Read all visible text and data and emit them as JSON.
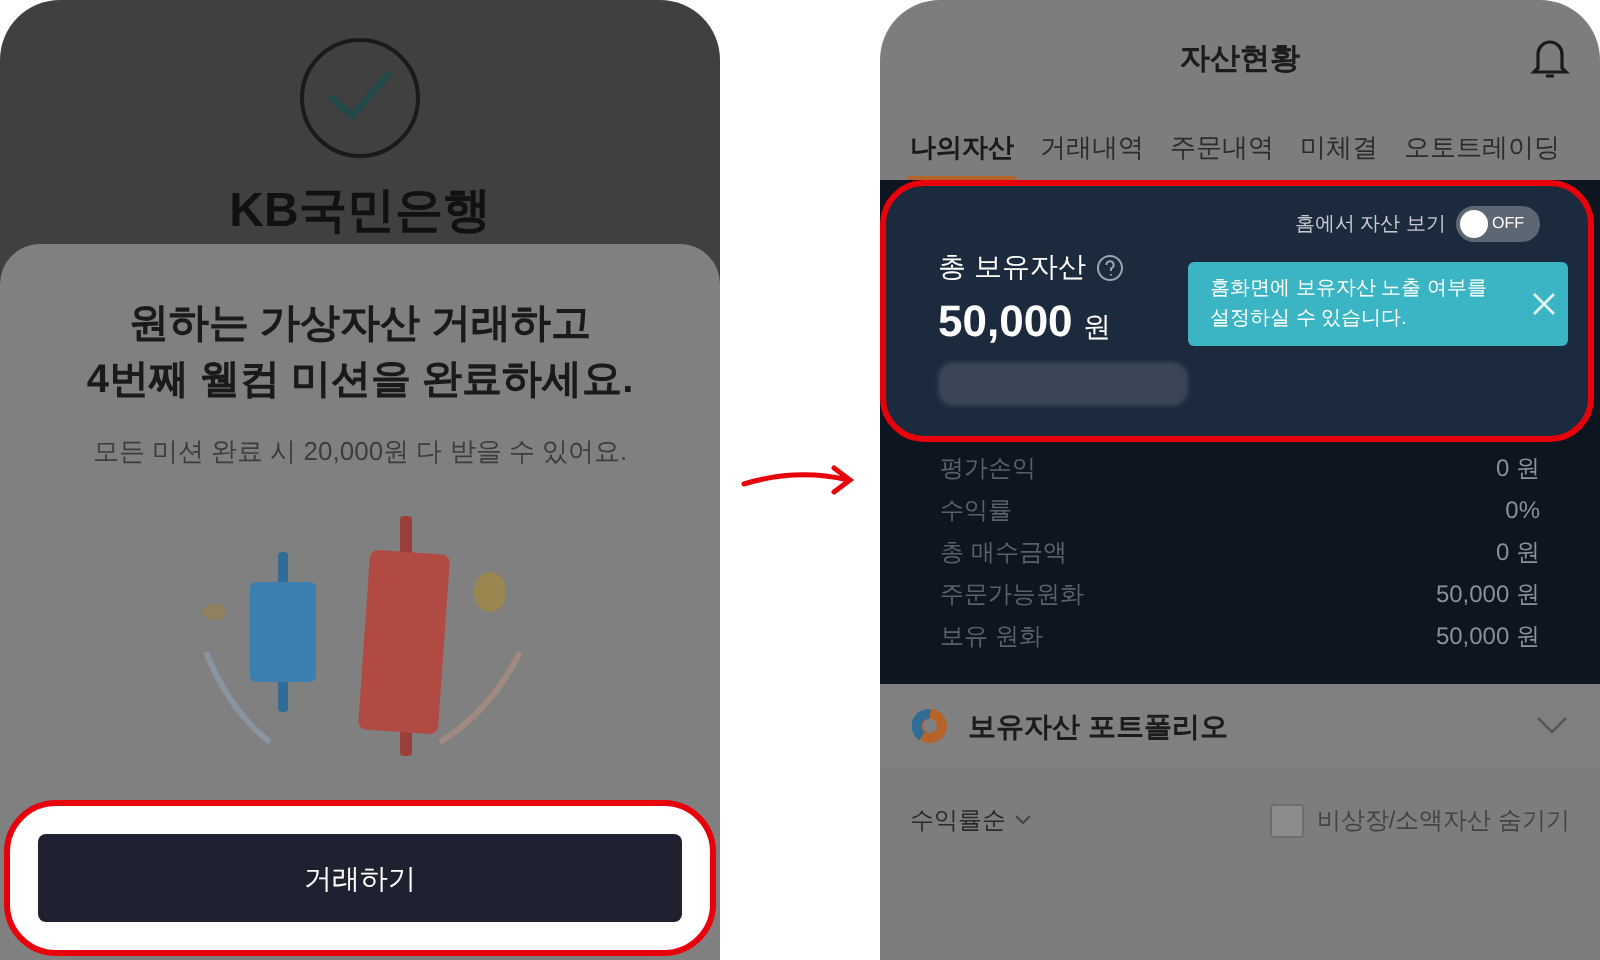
{
  "left_screen": {
    "bank_name": "KB국민은행",
    "sheet": {
      "title_lines": [
        "원하는 가상자산 거래하고",
        "4번째 웰컴 미션을 완료하세요."
      ],
      "subtitle": "모든 미션 완료 시 20,000원 다 받을 수 있어요.",
      "button": "거래하기"
    }
  },
  "right_screen": {
    "title": "자산현황",
    "tabs": [
      {
        "label": "나의자산",
        "selected": true
      },
      {
        "label": "거래내역",
        "selected": false
      },
      {
        "label": "주문내역",
        "selected": false
      },
      {
        "label": "미체결",
        "selected": false
      },
      {
        "label": "오토트레이딩",
        "selected": false
      }
    ],
    "summary": {
      "label": "총 보유자산",
      "amount": "50,000",
      "unit": "원",
      "home_toggle": {
        "label": "홈에서 자산 보기",
        "on": false,
        "state_text": "OFF"
      },
      "tooltip": "홈화면에 보유자산 노출 여부를 설정하실 수 있습니다."
    },
    "rows": [
      {
        "label": "평가손익",
        "value": "0 원"
      },
      {
        "label": "수익률",
        "value": "0%"
      },
      {
        "label": "총 매수금액",
        "value": "0 원"
      },
      {
        "label": "주문가능원화",
        "value": "50,000 원"
      },
      {
        "label": "보유 원화",
        "value": "50,000 원"
      }
    ],
    "portfolio": {
      "title": "보유자산 포트폴리오",
      "expanded": false
    },
    "sort": {
      "label": "수익률순"
    },
    "hide_small": {
      "label": "비상장/소액자산 숨기기",
      "checked": false
    }
  }
}
